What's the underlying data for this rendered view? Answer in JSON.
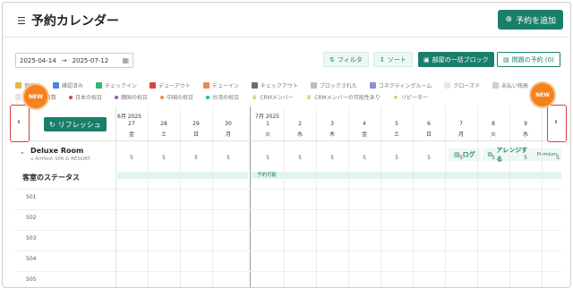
{
  "header": {
    "title": "予約カレンダー",
    "add_button": "予約を追加"
  },
  "toolbar": {
    "date_from": "2025-04-14",
    "date_separator": "→",
    "date_to": "2025-07-12",
    "filter": "フィルタ",
    "sort": "ソート",
    "bulk_block": "部屋の一括ブロック",
    "problem_reservations": "問題の予約 (0)"
  },
  "legend": {
    "row1": [
      {
        "label": "保留中",
        "color": "#e0b84a"
      },
      {
        "label": "確認済み",
        "color": "#4a86d6"
      },
      {
        "label": "チェックイン",
        "color": "#3cb371"
      },
      {
        "label": "デューアウト",
        "color": "#d64545"
      },
      {
        "label": "デューイン",
        "color": "#f08a4b"
      },
      {
        "label": "チェックアウト",
        "color": "#6d6d6d"
      },
      {
        "label": "ブロックされた",
        "color": "#bdbdbd"
      },
      {
        "label": "コネクティングルーム",
        "color": "#8a8fd6"
      },
      {
        "label": "クローズド",
        "color": "#e6e6e6"
      },
      {
        "label": "未払い残高",
        "color": "#cfcfcf"
      }
    ],
    "row2": [
      {
        "label": "ブロック日数",
        "color": "#e6e6e6",
        "kind": "swatch"
      },
      {
        "label": "日本の祝日",
        "color": "#d64545",
        "kind": "dot"
      },
      {
        "label": "韓国の祝日",
        "color": "#9b59b6",
        "kind": "dot"
      },
      {
        "label": "中国の祝日",
        "color": "#f08a4b",
        "kind": "dot"
      },
      {
        "label": "台湾の祝日",
        "color": "#1ab3b3",
        "kind": "dot"
      },
      {
        "label": "CRMメンバー",
        "color": "#e0b84a",
        "kind": "crown"
      },
      {
        "label": "CRMメンバーの可能性あり",
        "color": "#e0b84a",
        "kind": "crown"
      },
      {
        "label": "リピーター",
        "color": "#e0b84a",
        "kind": "star"
      }
    ]
  },
  "calendar": {
    "refresh_button": "リフレッシュ",
    "months": [
      {
        "label": "6月 2025"
      },
      {
        "label": "7月 2025"
      }
    ],
    "days": [
      {
        "num": "27",
        "dow": "金"
      },
      {
        "num": "28",
        "dow": "土"
      },
      {
        "num": "29",
        "dow": "日"
      },
      {
        "num": "30",
        "dow": "月"
      },
      {
        "num": "1",
        "dow": "火"
      },
      {
        "num": "2",
        "dow": "水"
      },
      {
        "num": "3",
        "dow": "木"
      },
      {
        "num": "4",
        "dow": "金"
      },
      {
        "num": "5",
        "dow": "土"
      },
      {
        "num": "6",
        "dow": "日"
      },
      {
        "num": "7",
        "dow": "月"
      },
      {
        "num": "8",
        "dow": "火"
      },
      {
        "num": "9",
        "dow": "水"
      },
      {
        "num": "10",
        "dow": "木"
      }
    ],
    "availability": [
      "5",
      "5",
      "5",
      "5",
      "5",
      "5",
      "5",
      "5",
      "5",
      "5",
      "5",
      "5",
      "5",
      "5"
    ],
    "room": {
      "name": "Deluxe Room",
      "property": "AirHost SPA & RESORT"
    },
    "log_button": "ログ",
    "arrange_button": "アレンジする",
    "premium_label": "Premium",
    "status_title": "客室のステータス",
    "status_text": "予約可能",
    "rooms": [
      "501",
      "502",
      "503",
      "504",
      "505"
    ]
  },
  "badges": {
    "new_left": "NEW",
    "new_right": "NEW"
  }
}
